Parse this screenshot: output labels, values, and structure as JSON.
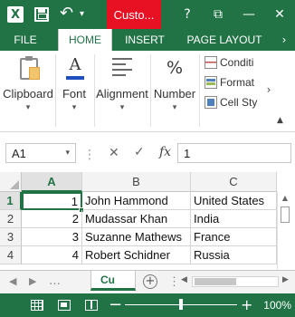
{
  "titlebar": {
    "app_icon_letter": "X",
    "tab_title": "Custo...",
    "help": "?",
    "minimize": "—",
    "close": "✕"
  },
  "tabs": {
    "file": "FILE",
    "home": "HOME",
    "insert": "INSERT",
    "page_layout": "PAGE LAYOUT"
  },
  "ribbon": {
    "clipboard": "Clipboard",
    "font": "Font",
    "alignment": "Alignment",
    "number": "Number",
    "number_icon": "%",
    "font_icon": "A",
    "styles": {
      "conditional": "Conditi",
      "format": "Format",
      "cell_styles": "Cell Sty"
    }
  },
  "formula_bar": {
    "name_box": "A1",
    "value": "1",
    "fx": "fx"
  },
  "grid": {
    "columns": [
      "A",
      "B",
      "C"
    ],
    "rows": [
      {
        "num": "1",
        "a": "1",
        "b": "John Hammond",
        "c": "United States"
      },
      {
        "num": "2",
        "a": "2",
        "b": "Mudassar Khan",
        "c": "India"
      },
      {
        "num": "3",
        "a": "3",
        "b": "Suzanne Mathews",
        "c": "France"
      },
      {
        "num": "4",
        "a": "4",
        "b": "Robert Schidner",
        "c": "Russia"
      }
    ],
    "active_cell": "A1"
  },
  "sheets": {
    "active_tab": "Cu"
  },
  "status": {
    "zoom": "100%",
    "zoom_value": 1.0
  },
  "colors": {
    "accent": "#217346",
    "title_tab": "#e81123"
  },
  "icons": {
    "title": [
      "excel-logo-icon",
      "save-icon",
      "undo-icon"
    ],
    "ribbon": [
      "clipboard-icon",
      "font-icon",
      "alignment-icon",
      "percent-icon",
      "conditional-formatting-icon",
      "format-table-icon",
      "cell-styles-icon"
    ],
    "status": [
      "normal-view-icon",
      "page-layout-view-icon",
      "page-break-view-icon"
    ]
  }
}
